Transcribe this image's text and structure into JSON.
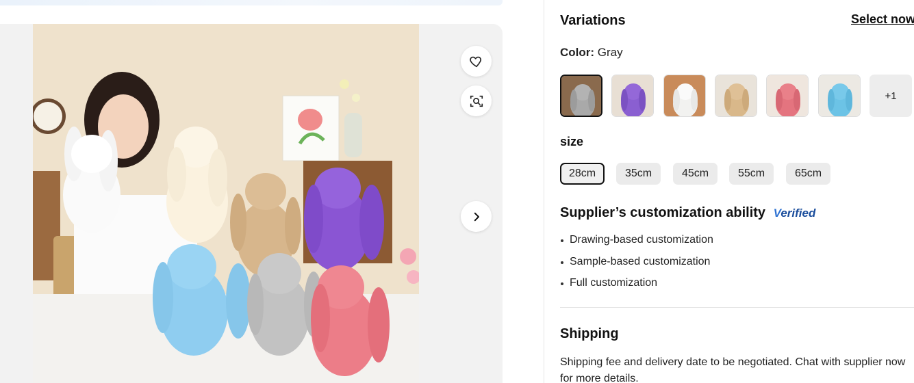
{
  "gallery": {
    "favorite_icon": "heart-icon",
    "visual_search_icon": "image-search-icon",
    "next_icon": "chevron-right-icon"
  },
  "variations": {
    "title": "Variations",
    "select_now": "Select now",
    "color_label": "Color:",
    "color_value": "Gray",
    "swatches": [
      {
        "color": "#a9a9a9",
        "selected": true
      },
      {
        "color": "#8a5fd1",
        "selected": false
      },
      {
        "color": "#f2f2f0",
        "selected": false
      },
      {
        "color": "#d9b88a",
        "selected": false
      },
      {
        "color": "#e4747f",
        "selected": false
      },
      {
        "color": "#6cc3e6",
        "selected": false
      }
    ],
    "more_label": "+1"
  },
  "size": {
    "title": "size",
    "options": [
      "28cm",
      "35cm",
      "45cm",
      "55cm",
      "65cm"
    ],
    "selected": "28cm"
  },
  "customization": {
    "title": "Supplier’s customization ability",
    "badge_v": "V",
    "badge_rest": "erified",
    "items": [
      "Drawing-based customization",
      "Sample-based customization",
      "Full customization"
    ]
  },
  "shipping": {
    "title": "Shipping",
    "text": "Shipping fee and delivery date to be negotiated. Chat with supplier now for more details."
  }
}
